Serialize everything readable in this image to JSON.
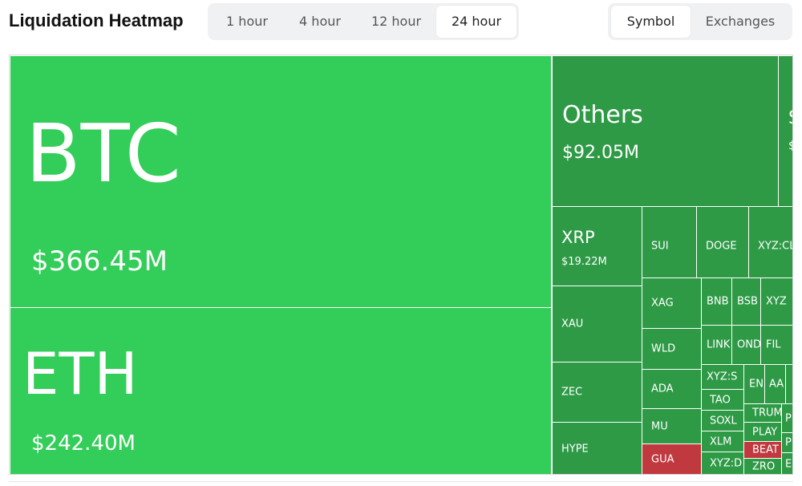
{
  "header": {
    "title": "Liquidation Heatmap",
    "time_tabs": [
      {
        "label": "1 hour",
        "active": false
      },
      {
        "label": "4 hour",
        "active": false
      },
      {
        "label": "12 hour",
        "active": false
      },
      {
        "label": "24 hour",
        "active": true
      }
    ],
    "view_tabs": [
      {
        "label": "Symbol",
        "active": true
      },
      {
        "label": "Exchanges",
        "active": false
      }
    ]
  },
  "colors": {
    "bright_green": "#33cd59",
    "dark_green": "#2e9a46",
    "red": "#c0393f"
  },
  "heatmap": {
    "btc": {
      "symbol": "BTC",
      "value": "$366.45M"
    },
    "eth": {
      "symbol": "ETH",
      "value": "$242.40M"
    },
    "others": {
      "symbol": "Others",
      "value": "$92.05M"
    },
    "sol_partial": {
      "symbol": "S",
      "value": "$"
    },
    "xrp": {
      "symbol": "XRP",
      "value": "$19.22M"
    },
    "small": {
      "sui": "SUI",
      "doge": "DOGE",
      "xyz_cl": "XYZ:CL",
      "xau": "XAU",
      "xag": "XAG",
      "bnb": "BNB",
      "bsb": "BSB",
      "xyz_a": "XYZ",
      "zec": "ZEC",
      "wld": "WLD",
      "link": "LINK",
      "ondo": "ONDO",
      "fil": "FIL",
      "ada": "ADA",
      "xyz_s": "XYZ:S",
      "en": "EN",
      "aa": "AA",
      "tao": "TAO",
      "hype": "HYPE",
      "mu": "MU",
      "soxl": "SOXL",
      "trump": "TRUMP",
      "play": "PLAY",
      "xlm": "XLM",
      "beat": "BEAT",
      "gua": "GUA",
      "xyz_d": "XYZ:D",
      "zro": "ZRO",
      "p1": "P",
      "p2": "P",
      "p3": "E"
    }
  }
}
